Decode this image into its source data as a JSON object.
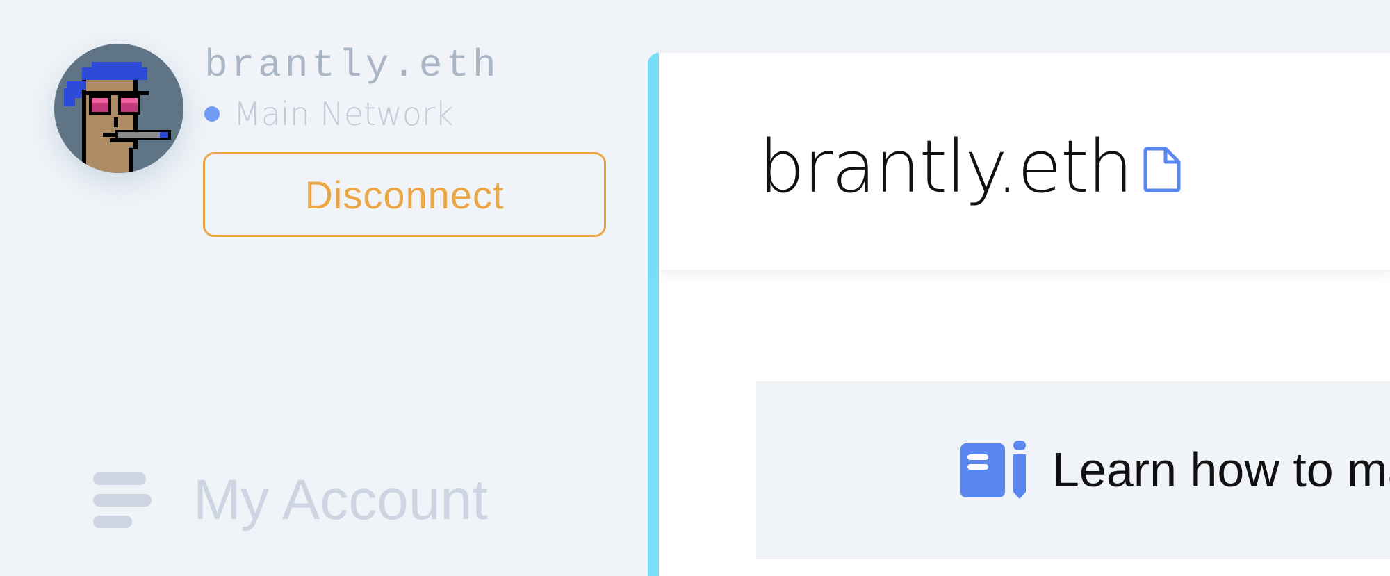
{
  "account": {
    "name": "brantly.eth",
    "network": "Main Network",
    "network_dot_color": "#6f9bf5",
    "avatar_icon": "pixel-punk-avatar"
  },
  "buttons": {
    "disconnect_label": "Disconnect",
    "disconnect_color": "#eba745"
  },
  "nav": {
    "items": [
      {
        "label": "My Account",
        "icon": "menu-lines-icon"
      }
    ]
  },
  "page": {
    "title": "brantly.eth",
    "title_icon": "document-icon",
    "accent_color": "#78dff7"
  },
  "notice": {
    "text": "Learn how to man",
    "icon": "manual-icon",
    "icon_color": "#5a86f0"
  }
}
